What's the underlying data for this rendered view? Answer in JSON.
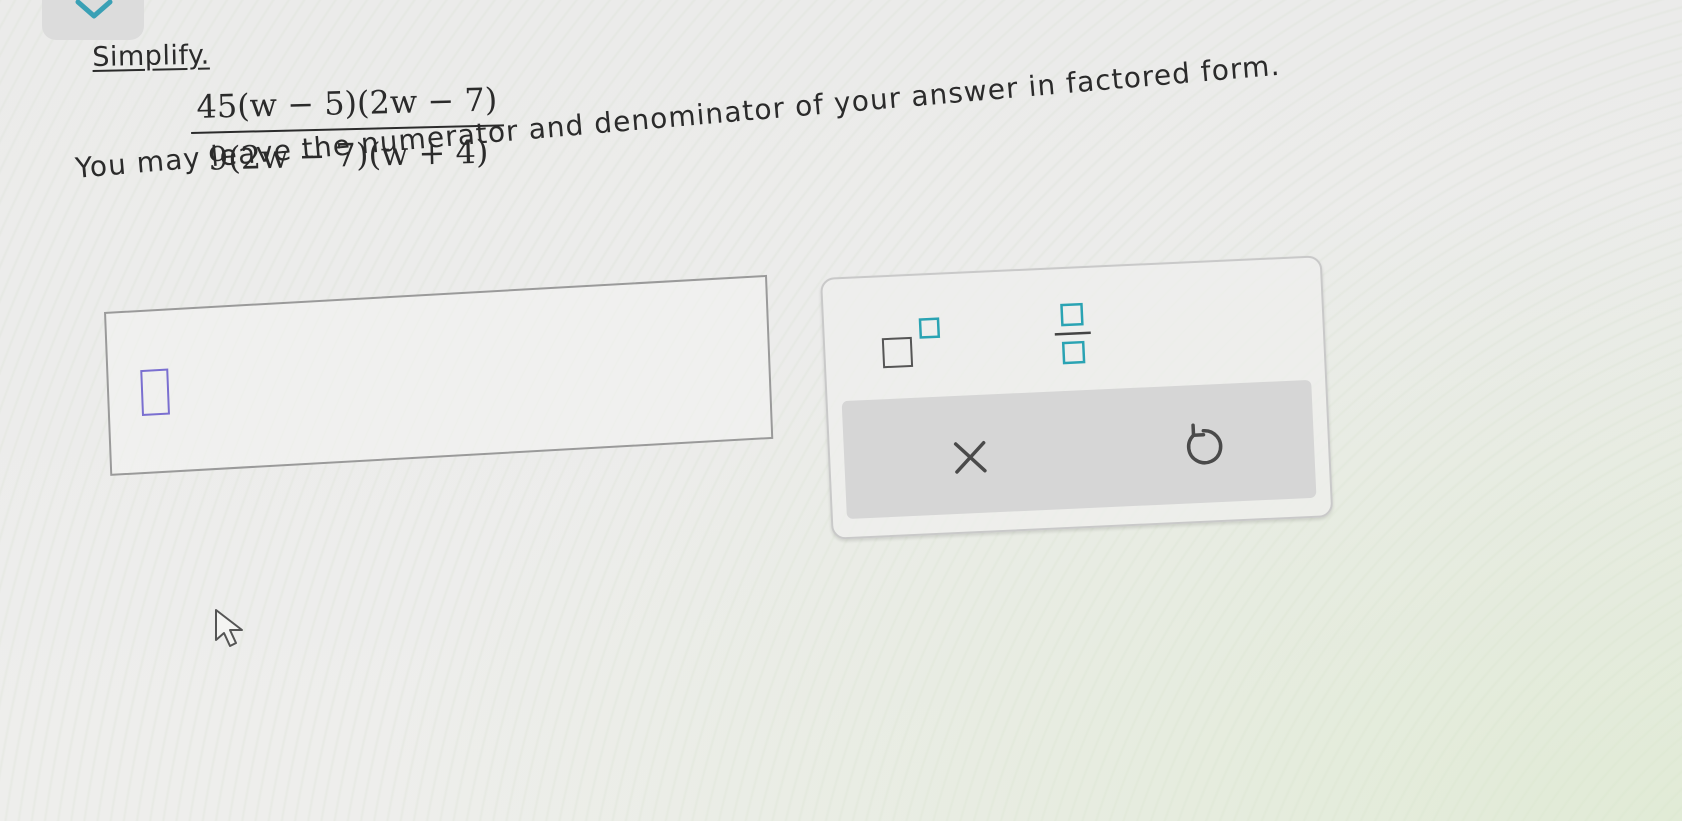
{
  "instruction": {
    "title": "Simplify."
  },
  "problem": {
    "numerator": "45(w − 5)(2w − 7)",
    "denominator": "9(2w − 7)(w + 4)"
  },
  "hint": "You may leave the numerator and denominator of your answer in factored form.",
  "palette": {
    "buttons": [
      "superscript-icon",
      "fraction-icon",
      "clear-icon",
      "undo-icon"
    ]
  },
  "colors": {
    "slot_accent": "#7a6fd0",
    "template_accent": "#2aa3b3",
    "action_bar": "#d6d6d6"
  }
}
